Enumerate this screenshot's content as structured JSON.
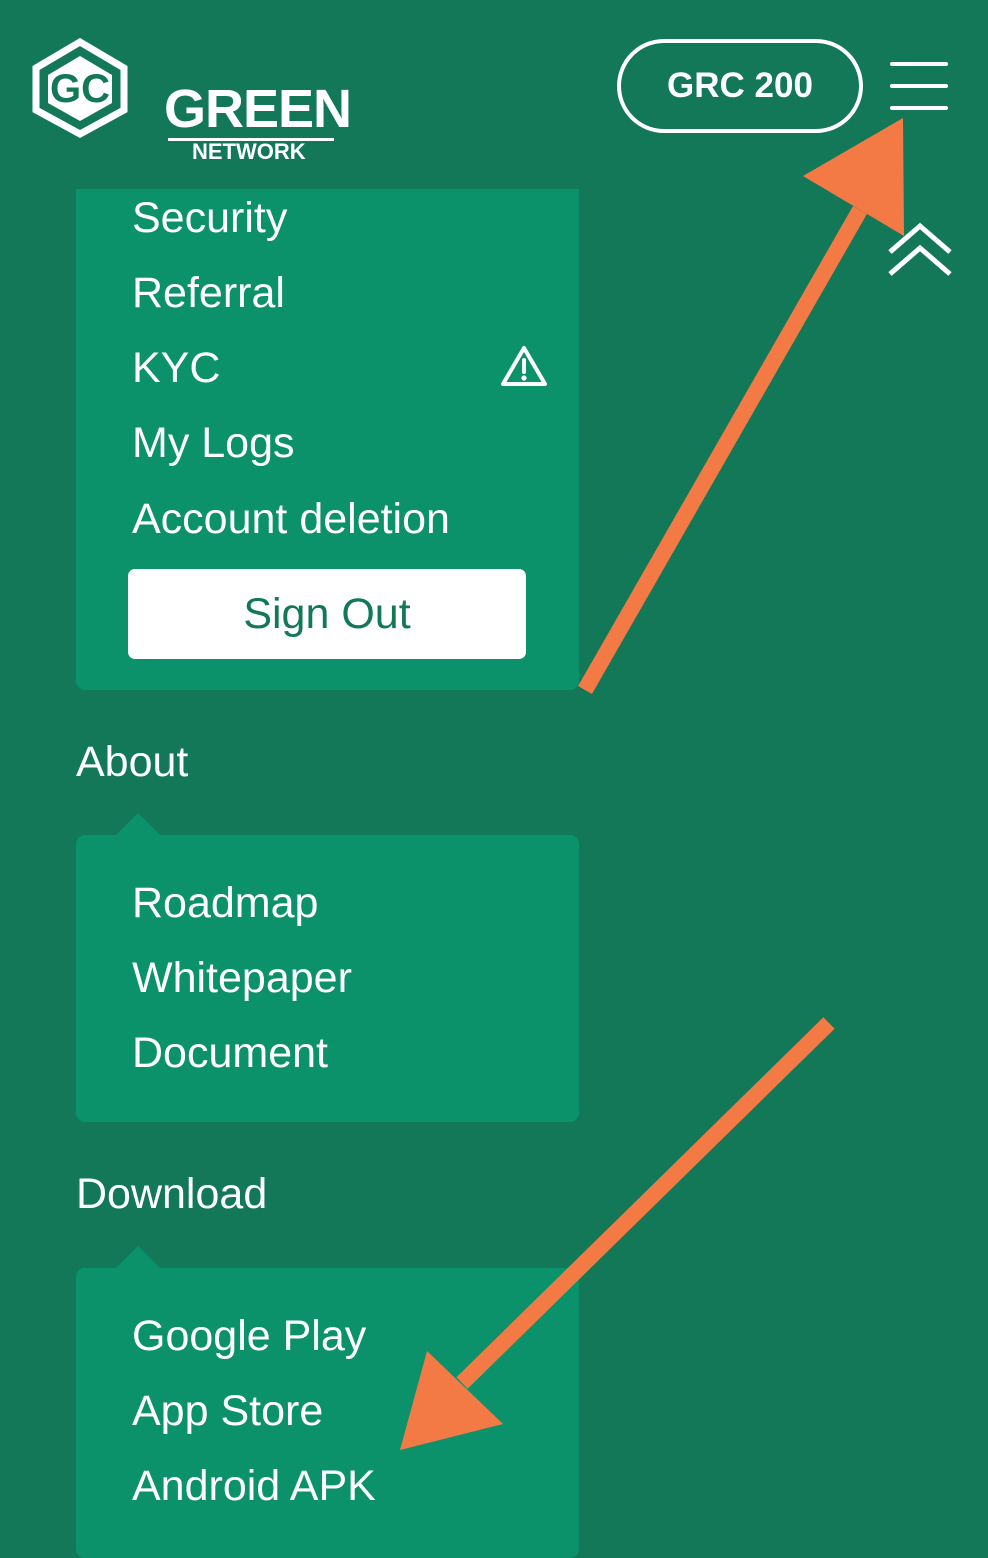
{
  "header": {
    "logo": {
      "title": "GREEN",
      "subtitle": "NETWORK",
      "mark": "GC"
    },
    "balance_label": "GRC 200",
    "menu_icon": "hamburger-menu-icon"
  },
  "account_menu": {
    "items": [
      {
        "label": "Security"
      },
      {
        "label": "Referral"
      },
      {
        "label": "KYC",
        "icon": "warning-icon"
      },
      {
        "label": "My Logs"
      },
      {
        "label": "Account deletion"
      }
    ],
    "sign_out_label": "Sign Out"
  },
  "about": {
    "title": "About",
    "items": [
      {
        "label": "Roadmap"
      },
      {
        "label": "Whitepaper"
      },
      {
        "label": "Document"
      }
    ]
  },
  "download": {
    "title": "Download",
    "items": [
      {
        "label": "Google Play"
      },
      {
        "label": "App Store"
      },
      {
        "label": "Android APK"
      }
    ]
  },
  "colors": {
    "background": "#127858",
    "panel": "#0b926a",
    "annotation_arrow": "#f47a45",
    "text": "#ffffff"
  }
}
